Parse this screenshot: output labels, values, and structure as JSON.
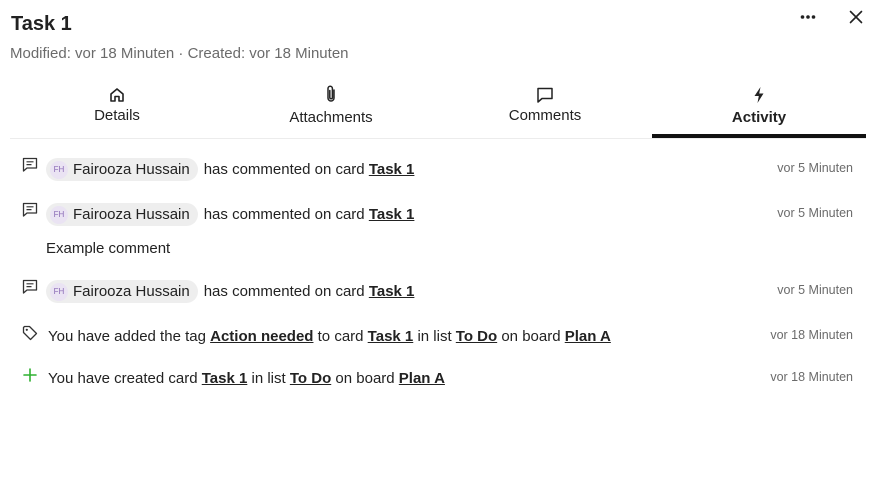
{
  "card": {
    "title": "Task 1",
    "meta": "Modified: vor 18 Minuten · Created: vor 18 Minuten"
  },
  "header_actions": {
    "more_icon": "more-horizontal-icon",
    "close_icon": "close-icon"
  },
  "tabs": [
    {
      "label": "Details",
      "icon": "home-icon",
      "active": false
    },
    {
      "label": "Attachments",
      "icon": "paperclip-icon",
      "active": false
    },
    {
      "label": "Comments",
      "icon": "comment-icon",
      "active": false
    },
    {
      "label": "Activity",
      "icon": "lightning-icon",
      "active": true
    }
  ],
  "activity": [
    {
      "icon": "comment-icon",
      "user": {
        "initials": "FH",
        "name": "Fairooza Hussain"
      },
      "text_before": "has commented on card",
      "card_link": "Task 1",
      "time": "vor 5 Minuten"
    },
    {
      "icon": "comment-icon",
      "user": {
        "initials": "FH",
        "name": "Fairooza Hussain"
      },
      "text_before": "has commented on card",
      "card_link": "Task 1",
      "time": "vor 5 Minuten",
      "comment": "Example comment"
    },
    {
      "icon": "comment-icon",
      "user": {
        "initials": "FH",
        "name": "Fairooza Hussain"
      },
      "text_before": "has commented on card",
      "card_link": "Task 1",
      "time": "vor 5 Minuten"
    },
    {
      "icon": "tag-icon",
      "p1": "You have added the tag",
      "tag_link": "Action needed",
      "p2": "to card",
      "card_link": "Task 1",
      "p3": "in list",
      "list_link": "To Do",
      "p4": "on board",
      "board_link": "Plan A",
      "time": "vor 18 Minuten"
    },
    {
      "icon": "plus-icon",
      "p1": "You have created card",
      "card_link": "Task 1",
      "p3": "in list",
      "list_link": "To Do",
      "p4": "on board",
      "board_link": "Plan A",
      "time": "vor 18 Minuten"
    }
  ],
  "colors": {
    "plus_icon": "#2fb130",
    "avatar_bg": "#eae3f3",
    "avatar_text": "#8a6bb5",
    "active_tab_underline": "#111111"
  }
}
